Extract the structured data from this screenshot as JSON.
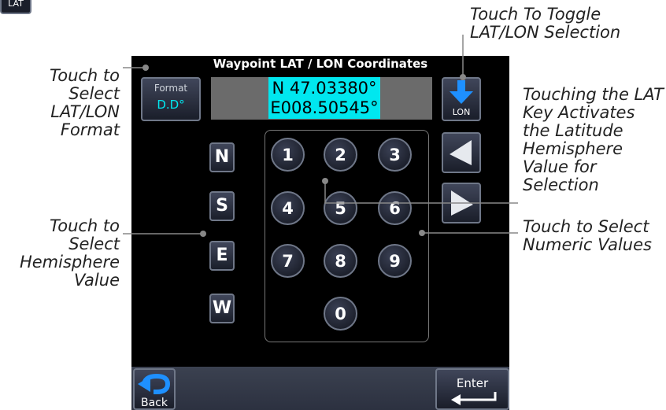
{
  "corner_key": {
    "label": "LAT"
  },
  "screen": {
    "title": "Waypoint LAT / LON Coordinates",
    "format_button": {
      "label": "Format",
      "value": "D.D°"
    },
    "lat_value": "N 47.03380°",
    "lon_value": "E008.50545°",
    "toggle_button": {
      "label": "LON"
    },
    "hemisphere_keys": [
      "N",
      "S",
      "E",
      "W"
    ],
    "numeric_keys": [
      "1",
      "2",
      "3",
      "4",
      "5",
      "6",
      "7",
      "8",
      "9",
      "0"
    ],
    "back_button": {
      "label": "Back"
    },
    "enter_button": {
      "label": "Enter"
    }
  },
  "callouts": {
    "toggle": "Touch To Toggle LAT/LON Selection",
    "format": "Touch to Select LAT/LON Format",
    "lat_key": "Touching the LAT Key Activates the Latitude Hemisphere Value for Selection",
    "hemisphere": "Touch to Select Hemisphere Value",
    "numeric": "Touch to Select Numeric Values"
  },
  "colors": {
    "highlight": "#00e7ef",
    "arrow_blue": "#1e90ff",
    "screen_bg": "#000000"
  }
}
